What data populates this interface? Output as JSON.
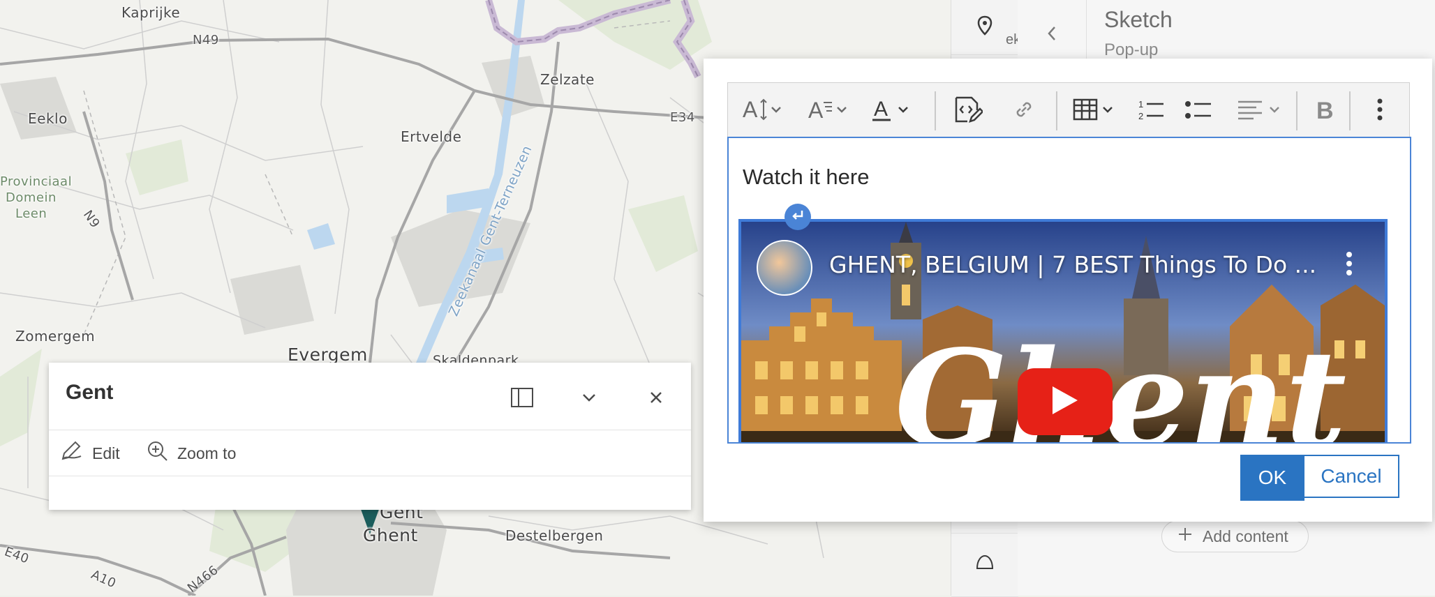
{
  "map": {
    "places": [
      {
        "name": "Kaprijke"
      },
      {
        "name": "N49"
      },
      {
        "name": "Zelzate"
      },
      {
        "name": "Eeklo"
      },
      {
        "name": "Ertvelde"
      },
      {
        "name": "E34"
      },
      {
        "name": "Provinciaal"
      },
      {
        "name": "Domein"
      },
      {
        "name": "Leen"
      },
      {
        "name": "N9"
      },
      {
        "name": "Zeekanaal Gent-Terneuzen"
      },
      {
        "name": "Zomergem"
      },
      {
        "name": "Evergem"
      },
      {
        "name": "Skaldenpark"
      },
      {
        "name": "Gent"
      },
      {
        "name": "Ghent"
      },
      {
        "name": "Destelbergen"
      },
      {
        "name": "E40"
      },
      {
        "name": "A10"
      },
      {
        "name": "N466"
      }
    ],
    "strip_label": "eke"
  },
  "popup": {
    "title": "Gent",
    "actions": {
      "edit": "Edit",
      "zoom_to": "Zoom to"
    },
    "icons": [
      "dock-icon",
      "chevron-down-icon",
      "close-icon",
      "pencil-icon",
      "zoom-to-icon"
    ]
  },
  "panel": {
    "title": "Sketch",
    "subtitle": "Pop-up",
    "add_content": "Add content"
  },
  "editor": {
    "text": "Watch it here",
    "video_title": "GHENT, BELGIUM | 7 BEST Things To Do ...",
    "video_overlay": "Ghent",
    "ok": "OK",
    "cancel": "Cancel",
    "accent": "#2a74c2",
    "focus": "#4a84d6"
  }
}
